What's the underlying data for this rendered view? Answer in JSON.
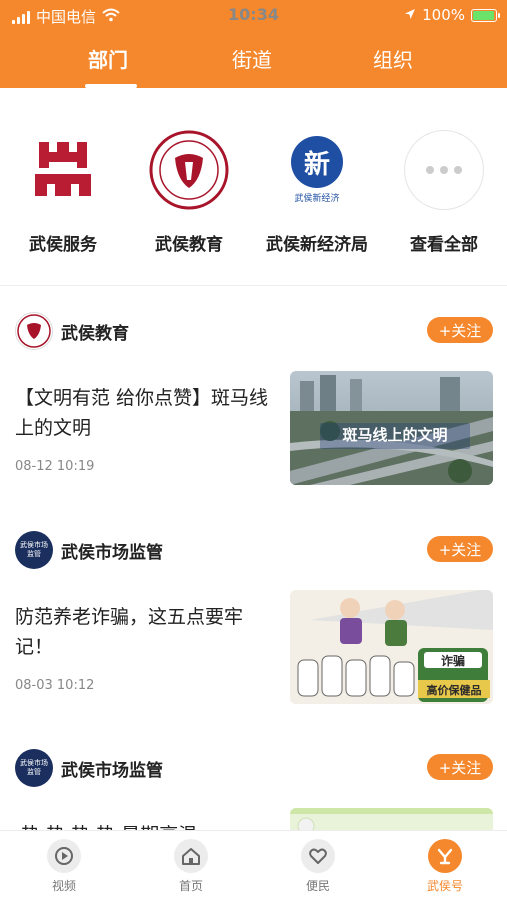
{
  "status": {
    "carrier": "中国电信",
    "time": "10:34",
    "battery": "100%",
    "battery_level": 1.0
  },
  "tabs": [
    {
      "label": "部门",
      "active": true
    },
    {
      "label": "街道",
      "active": false
    },
    {
      "label": "组织",
      "active": false
    }
  ],
  "departments": [
    {
      "name": "武侯服务",
      "icon": "wuhou-service-logo"
    },
    {
      "name": "武侯教育",
      "icon": "wuhou-education-logo"
    },
    {
      "name": "武侯新经济局",
      "icon": "new-economy-logo",
      "logo_text": "新",
      "logo_caption": "武侯新经济"
    },
    {
      "name": "查看全部",
      "icon": "more-icon"
    }
  ],
  "feed": [
    {
      "source": "武侯教育",
      "follow": "+关注",
      "title": "【文明有范 给你点赞】斑马线上的文明",
      "time": "08-12 10:19",
      "thumb_caption": "斑马线上的文明"
    },
    {
      "source": "武侯市场监管",
      "avatar_text": "武侯市场监管",
      "follow": "+关注",
      "title": "防范养老诈骗，这五点要牢记！",
      "time": "08-03 10:12",
      "thumb_caption": "高价保健品",
      "thumb_sign": "诈骗"
    },
    {
      "source": "武侯市场监管",
      "avatar_text": "武侯市场监管",
      "follow": "+关注",
      "title": "·热·热·热·热 暑期高温"
    }
  ],
  "nav": [
    {
      "label": "视频",
      "icon": "video-icon",
      "active": false
    },
    {
      "label": "首页",
      "icon": "home-icon",
      "active": false
    },
    {
      "label": "便民",
      "icon": "heart-icon",
      "active": false
    },
    {
      "label": "武侯号",
      "icon": "wuhou-account-icon",
      "active": true
    }
  ],
  "colors": {
    "accent": "#f5872c",
    "text": "#222222",
    "muted": "#888888"
  }
}
